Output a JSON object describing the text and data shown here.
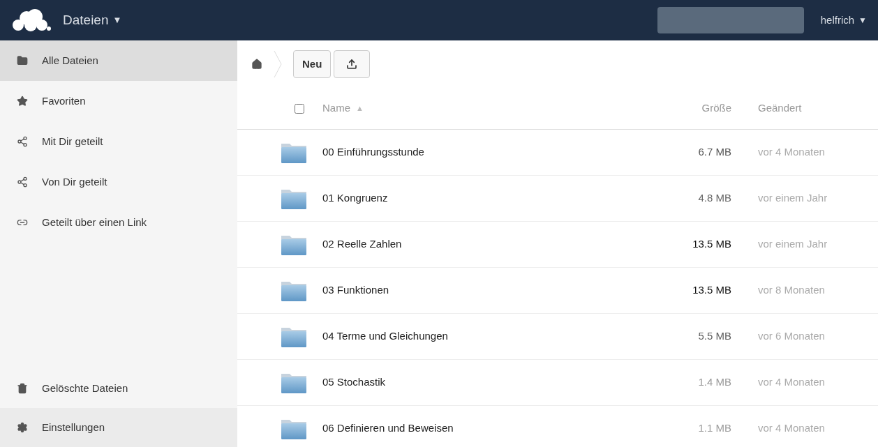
{
  "header": {
    "app_name": "Dateien",
    "app_caret": "▼",
    "user": "helfrich",
    "user_caret": "▼"
  },
  "sidebar": {
    "items": [
      {
        "kind": "folder",
        "label": "Alle Dateien",
        "selected": true
      },
      {
        "kind": "star",
        "label": "Favoriten",
        "selected": false
      },
      {
        "kind": "share",
        "label": "Mit Dir geteilt",
        "selected": false
      },
      {
        "kind": "share",
        "label": "Von Dir geteilt",
        "selected": false
      },
      {
        "kind": "link",
        "label": "Geteilt über einen Link",
        "selected": false
      }
    ],
    "bottom_items": [
      {
        "kind": "trash",
        "label": "Gelöschte Dateien"
      },
      {
        "kind": "gear",
        "label": "Einstellungen"
      }
    ]
  },
  "toolbar": {
    "new_button": "Neu"
  },
  "table": {
    "select_all_checked": false,
    "columns": [
      {
        "label": "Name",
        "sort_marker": "▲"
      },
      {
        "label": "Größe"
      },
      {
        "label": "Geändert"
      }
    ],
    "rows": [
      {
        "name": "00 Einführungsstunde",
        "size": "6.7 MB",
        "color": "#555555",
        "modified": "vor 4 Monaten"
      },
      {
        "name": "01 Kongruenz",
        "size": "4.8 MB",
        "color": "#666666",
        "modified": "vor einem Jahr"
      },
      {
        "name": "02 Reelle Zahlen",
        "size": "13.5 MB",
        "color": "#111111",
        "modified": "vor einem Jahr"
      },
      {
        "name": "03 Funktionen",
        "size": "13.5 MB",
        "color": "#111111",
        "modified": "vor 8 Monaten"
      },
      {
        "name": "04 Terme und Gleichungen",
        "size": "5.5 MB",
        "color": "#5e5e5e",
        "modified": "vor 6 Monaten"
      },
      {
        "name": "05 Stochastik",
        "size": "1.4 MB",
        "color": "#999999",
        "modified": "vor 4 Monaten"
      },
      {
        "name": "06 Definieren und Beweisen",
        "size": "1.1 MB",
        "color": "#9c9c9c",
        "modified": "vor 4 Monaten"
      }
    ]
  }
}
